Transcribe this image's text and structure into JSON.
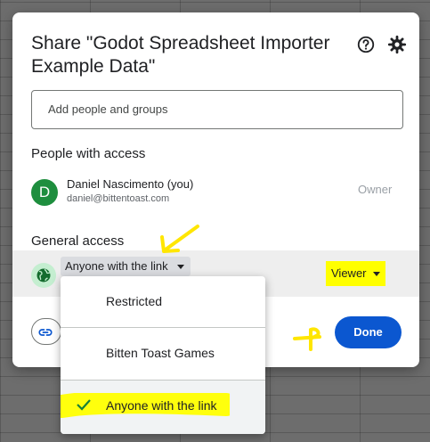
{
  "dialog": {
    "title": "Share \"Godot Spreadsheet Importer Example Data\"",
    "add_placeholder": "Add people and groups",
    "people_heading": "People with access",
    "person": {
      "initial": "D",
      "name": "Daniel Nascimento (you)",
      "email": "daniel@bittentoast.com",
      "role": "Owner"
    },
    "general_heading": "General access",
    "access_value": "Anyone with the link",
    "role_value": "Viewer",
    "done_label": "Done"
  },
  "menu": {
    "items": [
      {
        "label": "Restricted"
      },
      {
        "label": "Bitten Toast Games"
      },
      {
        "label": "Anyone with the link"
      }
    ]
  },
  "colors": {
    "accent": "#0b57d0",
    "highlight": "#ffff00",
    "avatar": "#1e8e3e"
  },
  "icons": [
    "help-icon",
    "gear-icon",
    "globe-icon",
    "link-icon",
    "check-icon",
    "chevron-down-icon"
  ]
}
